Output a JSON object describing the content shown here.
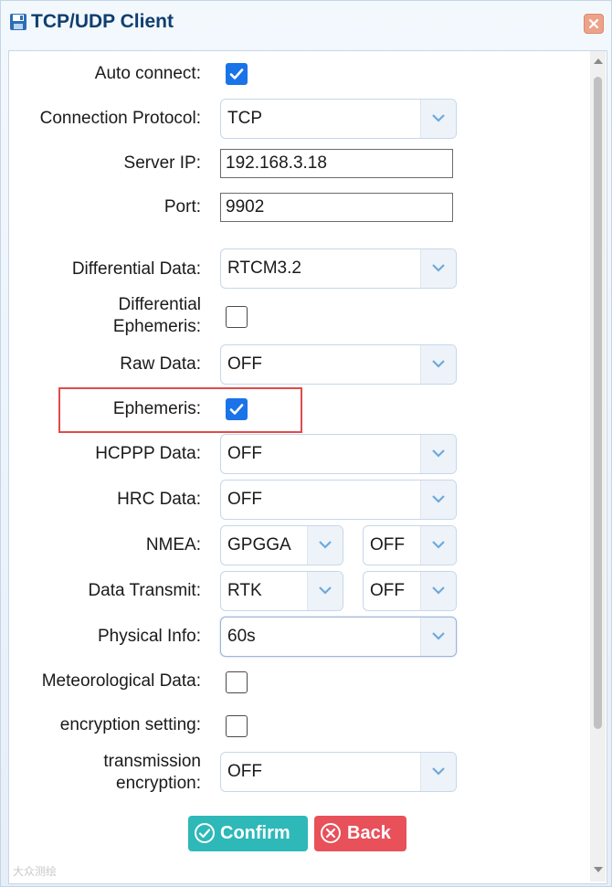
{
  "window": {
    "title": "TCP/UDP Client",
    "icon": "floppy-disk-icon",
    "close_icon": "close-icon"
  },
  "fields": {
    "auto_connect": {
      "label": "Auto connect:",
      "checked": true
    },
    "connection_protocol": {
      "label": "Connection Protocol:",
      "value": "TCP"
    },
    "server_ip": {
      "label": "Server IP:",
      "value": "192.168.3.18"
    },
    "port": {
      "label": "Port:",
      "value": "9902"
    },
    "differential_data": {
      "label": "Differential Data:",
      "value": "RTCM3.2"
    },
    "differential_ephemeris": {
      "label_line1": "Differential",
      "label_line2": "Ephemeris:",
      "checked": false
    },
    "raw_data": {
      "label": "Raw Data:",
      "value": "OFF"
    },
    "ephemeris": {
      "label": "Ephemeris:",
      "checked": true
    },
    "hcppp_data": {
      "label": "HCPPP Data:",
      "value": "OFF"
    },
    "hrc_data": {
      "label": "HRC Data:",
      "value": "OFF"
    },
    "nmea": {
      "label": "NMEA:",
      "type_value": "GPGGA",
      "rate_value": "OFF"
    },
    "data_transmit": {
      "label": "Data Transmit:",
      "type_value": "RTK",
      "rate_value": "OFF"
    },
    "physical_info": {
      "label": "Physical Info:",
      "value": "60s"
    },
    "meteorological_data": {
      "label": "Meteorological Data:",
      "checked": false
    },
    "encryption_setting": {
      "label": "encryption setting:",
      "checked": false
    },
    "transmission_encryption": {
      "label_line1": "transmission",
      "label_line2": "encryption:",
      "value": "OFF"
    }
  },
  "buttons": {
    "confirm": "Confirm",
    "back": "Back"
  },
  "watermark": "大众测绘",
  "colors": {
    "accent": "#1a73e8",
    "confirm": "#2eb8b8",
    "back": "#e8505a",
    "title": "#0e3f70",
    "highlight": "#e04b4b"
  }
}
